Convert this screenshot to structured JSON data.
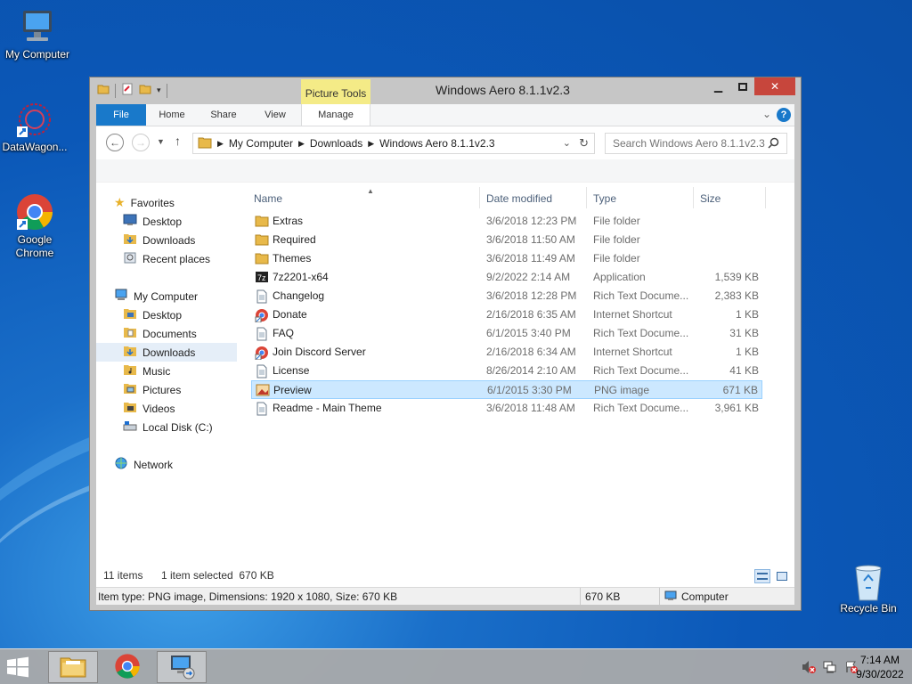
{
  "desktop": {
    "icons": [
      {
        "label": "My Computer",
        "icon": "my-computer-icon"
      },
      {
        "label": "DataWagon...",
        "icon": "datawagon-icon"
      },
      {
        "label": "Google Chrome",
        "icon": "chrome-icon"
      },
      {
        "label": "Recycle Bin",
        "icon": "recycle-bin-icon"
      }
    ]
  },
  "window": {
    "title": "Windows Aero 8.1.1v2.3",
    "contextual_tab": "Picture Tools",
    "ribbon_tabs": [
      "File",
      "Home",
      "Share",
      "View",
      "Manage"
    ],
    "address": {
      "crumbs": [
        "My Computer",
        "Downloads",
        "Windows Aero 8.1.1v2.3"
      ]
    },
    "search": {
      "placeholder": "Search Windows Aero 8.1.1v2.3"
    },
    "nav": {
      "favorites": "Favorites",
      "desktop": "Desktop",
      "downloads": "Downloads",
      "recent": "Recent places",
      "my_computer": "My Computer",
      "pc_desktop": "Desktop",
      "documents": "Documents",
      "pc_downloads": "Downloads",
      "music": "Music",
      "pictures": "Pictures",
      "videos": "Videos",
      "local_disk": "Local Disk (C:)",
      "network": "Network"
    },
    "columns": {
      "name": "Name",
      "date": "Date modified",
      "type": "Type",
      "size": "Size"
    },
    "files": [
      {
        "name": "Extras",
        "date": "3/6/2018 12:23 PM",
        "type": "File folder",
        "size": "",
        "icon": "folder-icon"
      },
      {
        "name": "Required",
        "date": "3/6/2018 11:50 AM",
        "type": "File folder",
        "size": "",
        "icon": "folder-icon"
      },
      {
        "name": "Themes",
        "date": "3/6/2018 11:49 AM",
        "type": "File folder",
        "size": "",
        "icon": "folder-icon"
      },
      {
        "name": "7z2201-x64",
        "date": "9/2/2022 2:14 AM",
        "type": "Application",
        "size": "1,539 KB",
        "icon": "7zip-icon"
      },
      {
        "name": "Changelog",
        "date": "3/6/2018 12:28 PM",
        "type": "Rich Text Docume...",
        "size": "2,383 KB",
        "icon": "document-icon"
      },
      {
        "name": "Donate",
        "date": "2/16/2018 6:35 AM",
        "type": "Internet Shortcut",
        "size": "1 KB",
        "icon": "shortcut-icon"
      },
      {
        "name": "FAQ",
        "date": "6/1/2015 3:40 PM",
        "type": "Rich Text Docume...",
        "size": "31 KB",
        "icon": "document-icon"
      },
      {
        "name": "Join Discord Server",
        "date": "2/16/2018 6:34 AM",
        "type": "Internet Shortcut",
        "size": "1 KB",
        "icon": "shortcut-icon"
      },
      {
        "name": "License",
        "date": "8/26/2014 2:10 AM",
        "type": "Rich Text Docume...",
        "size": "41 KB",
        "icon": "document-icon"
      },
      {
        "name": "Preview",
        "date": "6/1/2015 3:30 PM",
        "type": "PNG image",
        "size": "671 KB",
        "icon": "image-icon",
        "selected": true
      },
      {
        "name": "Readme - Main Theme",
        "date": "3/6/2018 11:48 AM",
        "type": "Rich Text Docume...",
        "size": "3,961 KB",
        "icon": "document-icon"
      }
    ],
    "status": {
      "items": "11 items",
      "selected": "1 item selected  670 KB",
      "details": "Item type: PNG image, Dimensions: 1920 x 1080, Size: 670 KB",
      "size": "670 KB",
      "location": "Computer"
    }
  },
  "taskbar": {
    "clock_time": "7:14 AM",
    "clock_date": "9/30/2022"
  },
  "colors": {
    "accent": "#1979ca",
    "selection": "#cce8ff",
    "close": "#c7463c",
    "contextual": "#f4eb87"
  }
}
